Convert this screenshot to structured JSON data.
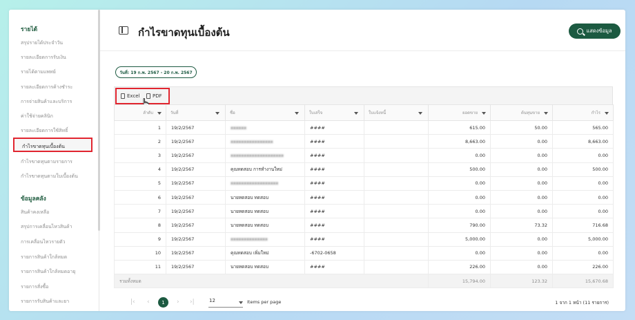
{
  "sidebar": {
    "sections": [
      {
        "heading": "รายได้",
        "items": [
          "สรุปรายได้ประจำวัน",
          "รายละเอียดการรับเงิน",
          "รายได้ตามแพทย์",
          "รายละเอียดการค้างชำระ",
          "การจ่ายสินค้าและบริการ",
          "ค่าใช้จ่ายคลินิก",
          "รายละเอียดการใช้สิทธิ์",
          "กำไรขาดทุนเบื้องต้น",
          "กำไรขาดทุนตามรายการ",
          "กำไรขาดทุนตามใบเบื้องต้น"
        ]
      },
      {
        "heading": "ข้อมูลคลัง",
        "items": [
          "สินค้าคงเหลือ",
          "สรุปการเคลื่อนไหวสินค้า",
          "การเคลื่อนไหวรายตัว",
          "รายการสินค้าใกล้หมด",
          "รายการสินค้าใกล้หมดอายุ",
          "รายการสั่งซื้อ",
          "รายการรับสินค้าและยา"
        ]
      }
    ],
    "active_item": "กำไรขาดทุนเบื้องต้น"
  },
  "header": {
    "title": "กำไรขาดทุนเบื้องต้น",
    "show_button": "แสดงข้อมูล"
  },
  "date_filter": "วันที่: 19 ก.พ. 2567 - 20 ก.พ. 2567",
  "toolbar": {
    "excel_label": "Excel",
    "pdf_label": "PDF"
  },
  "table": {
    "columns": [
      "ลำดับ",
      "วันที่",
      "ชื่อ",
      "ใบเสร็จ",
      "ใบแจ้งหนี้",
      "ยอดขาย",
      "ต้นทุนขาย",
      "กำไร"
    ],
    "rows": [
      [
        "1",
        "19/2/2567",
        "xxxxxx",
        "####",
        "",
        "615.00",
        "50.00",
        "565.00"
      ],
      [
        "2",
        "19/2/2567",
        "xxxxxxxxxxxxxxxx",
        "####",
        "",
        "8,663.00",
        "0.00",
        "8,663.00"
      ],
      [
        "3",
        "19/2/2567",
        "xxxxxxxxxxxxxxxxxxxx",
        "####",
        "",
        "0.00",
        "0.00",
        "0.00"
      ],
      [
        "4",
        "19/2/2567",
        "คุณทดสอบ การทำงานใหม่",
        "####",
        "",
        "500.00",
        "0.00",
        "500.00"
      ],
      [
        "5",
        "19/2/2567",
        "xxxxxxxxxxxxxxxxxx",
        "####",
        "",
        "0.00",
        "0.00",
        "0.00"
      ],
      [
        "6",
        "19/2/2567",
        "นายทดสอบ ทดสอบ",
        "####",
        "",
        "0.00",
        "0.00",
        "0.00"
      ],
      [
        "7",
        "19/2/2567",
        "นายทดสอบ ทดสอบ",
        "####",
        "",
        "0.00",
        "0.00",
        "0.00"
      ],
      [
        "8",
        "19/2/2567",
        "นายทดสอบ ทดสอบ",
        "####",
        "",
        "790.00",
        "73.32",
        "716.68"
      ],
      [
        "9",
        "19/2/2567",
        "xxxxxxxxxxxxxx",
        "####",
        "",
        "5,000.00",
        "0.00",
        "5,000.00"
      ],
      [
        "10",
        "19/2/2567",
        "คุณทดสอบ เพิ่มใหม่",
        "-6702-0658",
        "",
        "0.00",
        "0.00",
        "0.00"
      ],
      [
        "11",
        "19/2/2567",
        "นายทดสอบ ทดสอบ",
        "####",
        "",
        "226.00",
        "0.00",
        "226.00"
      ]
    ],
    "blurred_rows": [
      0,
      1,
      2,
      4,
      8
    ],
    "summary": {
      "label": "รวมทั้งหมด",
      "sales": "15,794.00",
      "cost": "123.32",
      "profit": "15,670.68"
    }
  },
  "pagination": {
    "current_page": "1",
    "page_size": "12",
    "items_per_page_label": "Items per page",
    "range_text": "1 จาก 1 หน้า (11 รายการ)"
  }
}
